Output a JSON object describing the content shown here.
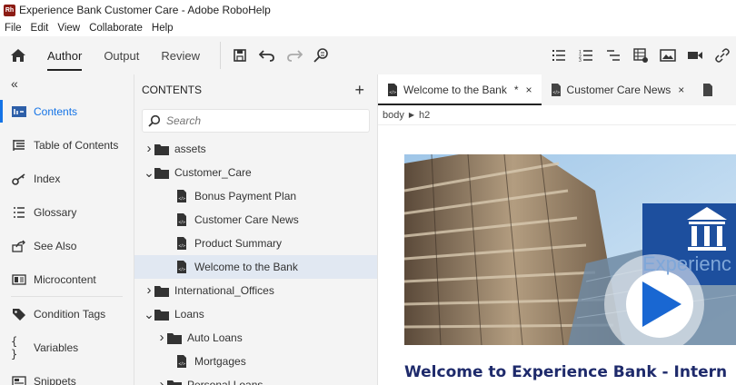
{
  "window": {
    "title": "Experience Bank Customer Care - Adobe RoboHelp",
    "logo_text": "Rh"
  },
  "menu": [
    "File",
    "Edit",
    "View",
    "Collaborate",
    "Help"
  ],
  "toolbar": {
    "modes": [
      "Author",
      "Output",
      "Review"
    ],
    "active_mode": "Author"
  },
  "leftnav": {
    "collapse_glyph": "«",
    "items": [
      {
        "label": "Contents",
        "icon": "contents-icon",
        "active": true
      },
      {
        "label": "Table of Contents",
        "icon": "toc-icon"
      },
      {
        "label": "Index",
        "icon": "index-key-icon"
      },
      {
        "label": "Glossary",
        "icon": "glossary-icon"
      },
      {
        "label": "See Also",
        "icon": "see-also-icon"
      },
      {
        "label": "Microcontent",
        "icon": "microcontent-icon"
      },
      {
        "label": "Condition Tags",
        "icon": "tag-icon"
      },
      {
        "label": "Variables",
        "icon": "variables-icon"
      },
      {
        "label": "Snippets",
        "icon": "snippets-icon"
      }
    ]
  },
  "contents": {
    "title": "CONTENTS",
    "add_glyph": "+",
    "search_placeholder": "Search",
    "tree": [
      {
        "label": "assets",
        "type": "folder",
        "level": 0,
        "expanded": false
      },
      {
        "label": "Customer_Care",
        "type": "folder",
        "level": 0,
        "expanded": true
      },
      {
        "label": "Bonus Payment Plan",
        "type": "file",
        "level": 1
      },
      {
        "label": "Customer Care News",
        "type": "file",
        "level": 1
      },
      {
        "label": "Product Summary",
        "type": "file",
        "level": 1
      },
      {
        "label": "Welcome to the Bank",
        "type": "file",
        "level": 1,
        "selected": true
      },
      {
        "label": "International_Offices",
        "type": "folder",
        "level": 0,
        "expanded": false
      },
      {
        "label": "Loans",
        "type": "folder",
        "level": 0,
        "expanded": true
      },
      {
        "label": "Auto Loans",
        "type": "folder",
        "level": 1,
        "expanded": false
      },
      {
        "label": "Mortgages",
        "type": "file",
        "level": 1
      },
      {
        "label": "Personal Loans",
        "type": "folder",
        "level": 1,
        "expanded": false
      }
    ]
  },
  "editor": {
    "tabs": [
      {
        "label": "Welcome to the Bank",
        "modified_mark": "*",
        "close": "×",
        "active": true
      },
      {
        "label": "Customer Care News",
        "close": "×"
      }
    ],
    "breadcrumb": [
      "body",
      "h2"
    ],
    "hero_overlay_text": "Experienc",
    "heading": "Welcome to Experience Bank - Intern"
  },
  "colors": {
    "accent": "#1473e6",
    "heading": "#1e2a6b",
    "play": "#1967d2",
    "logo_blue": "#1d4f9e",
    "logo_red": "#8c1c14"
  }
}
